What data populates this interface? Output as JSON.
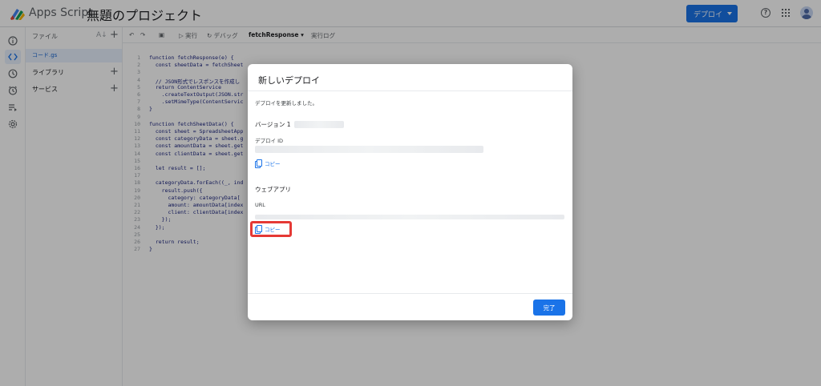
{
  "topbar": {
    "app_name": "Apps Script",
    "project_name": "無題のプロジェクト",
    "deploy_label": "デプロイ",
    "help_icon": "help-circle-icon",
    "apps_icon": "apps-grid-icon",
    "avatar_icon": "account-avatar"
  },
  "rail": {
    "items": [
      "overview-icon",
      "editor-icon",
      "triggers-history-icon",
      "triggers-icon",
      "executions-icon",
      "settings-icon"
    ],
    "active_index": 1
  },
  "files_panel": {
    "header": "ファイル",
    "sort_icon": "az-sort-icon",
    "add_icon": "plus-icon",
    "active_file": "コード.gs",
    "libraries": "ライブラリ",
    "services": "サービス"
  },
  "toolbar": {
    "undo_icon": "undo-icon",
    "redo_icon": "redo-icon",
    "save_icon": "save-icon",
    "run": "実行",
    "debug": "デバッグ",
    "function_name": "fetchResponse",
    "exec_log": "実行ログ"
  },
  "editor": {
    "line_numbers": [
      "1",
      "2",
      "3",
      "4",
      "5",
      "6",
      "7",
      "8",
      "9",
      "10",
      "11",
      "12",
      "13",
      "14",
      "15",
      "16",
      "17",
      "18",
      "19",
      "20",
      "21",
      "22",
      "23",
      "24",
      "25",
      "26",
      "27"
    ],
    "lines": [
      "function fetchResponse(e) {",
      "  const sheetData = fetchSheet",
      "",
      "  // JSON形式でレスポンスを作成し",
      "  return ContentService",
      "    .createTextOutput(JSON.str",
      "    .setMimeType(ContentServic",
      "}",
      "",
      "function fetchSheetData() {",
      "  const sheet = SpreadsheetApp",
      "  const categoryData = sheet.g",
      "  const amountData = sheet.get",
      "  const clientData = sheet.get",
      "",
      "  let result = [];",
      "",
      "  categoryData.forEach((_, ind",
      "    result.push({",
      "      category: categoryData[",
      "      amount: amountData[index",
      "      client: clientData[index",
      "    });",
      "  });",
      "",
      "  return result;",
      "}"
    ]
  },
  "dialog": {
    "title": "新しいデプロイ",
    "message": "デプロイを更新しました。",
    "version_label": "バージョン 1",
    "deploy_id_label": "デプロイ ID",
    "copy_label_1": "コピー",
    "webapp_label": "ウェブアプリ",
    "url_label": "URL",
    "copy_label_2": "コピー",
    "done_label": "完了"
  },
  "colors": {
    "accent": "#1a73e8",
    "highlight": "#e53935"
  }
}
